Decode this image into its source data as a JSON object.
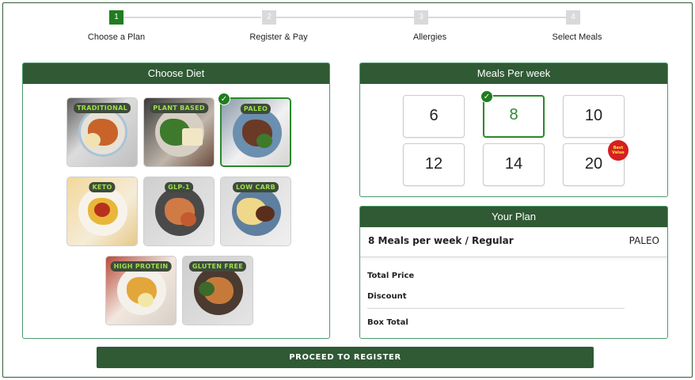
{
  "stepper": {
    "steps": [
      {
        "number": "1",
        "label": "Choose a Plan",
        "active": true
      },
      {
        "number": "2",
        "label": "Register & Pay",
        "active": false
      },
      {
        "number": "3",
        "label": "Allergies",
        "active": false
      },
      {
        "number": "4",
        "label": "Select Meals",
        "active": false
      }
    ]
  },
  "diet_panel": {
    "title": "Choose Diet",
    "diets": [
      {
        "label": "TRADITIONAL",
        "selected": false
      },
      {
        "label": "PLANT BASED",
        "selected": false
      },
      {
        "label": "PALEO",
        "selected": true
      },
      {
        "label": "KETO",
        "selected": false
      },
      {
        "label": "GLP-1",
        "selected": false
      },
      {
        "label": "LOW CARB",
        "selected": false
      },
      {
        "label": "HIGH PROTEIN",
        "selected": false
      },
      {
        "label": "GLUTEN FREE",
        "selected": false
      }
    ]
  },
  "meals_panel": {
    "title": "Meals Per week",
    "options": [
      "6",
      "8",
      "10",
      "12",
      "14",
      "20"
    ],
    "selected": "8",
    "best_value_badge": {
      "line1": "Best",
      "line2": "Value"
    }
  },
  "plan_panel": {
    "title": "Your Plan",
    "summary": "8 Meals per week / Regular",
    "diet": "PALEO",
    "total_price_label": "Total Price",
    "discount_label": "Discount",
    "box_total_label": "Box Total"
  },
  "proceed_button": "PROCEED TO REGISTER",
  "colors": {
    "header_green": "#2f5a34",
    "accent_green": "#1f7d1f",
    "label_lime": "#9be04a",
    "badge_red": "#d61f1f"
  }
}
